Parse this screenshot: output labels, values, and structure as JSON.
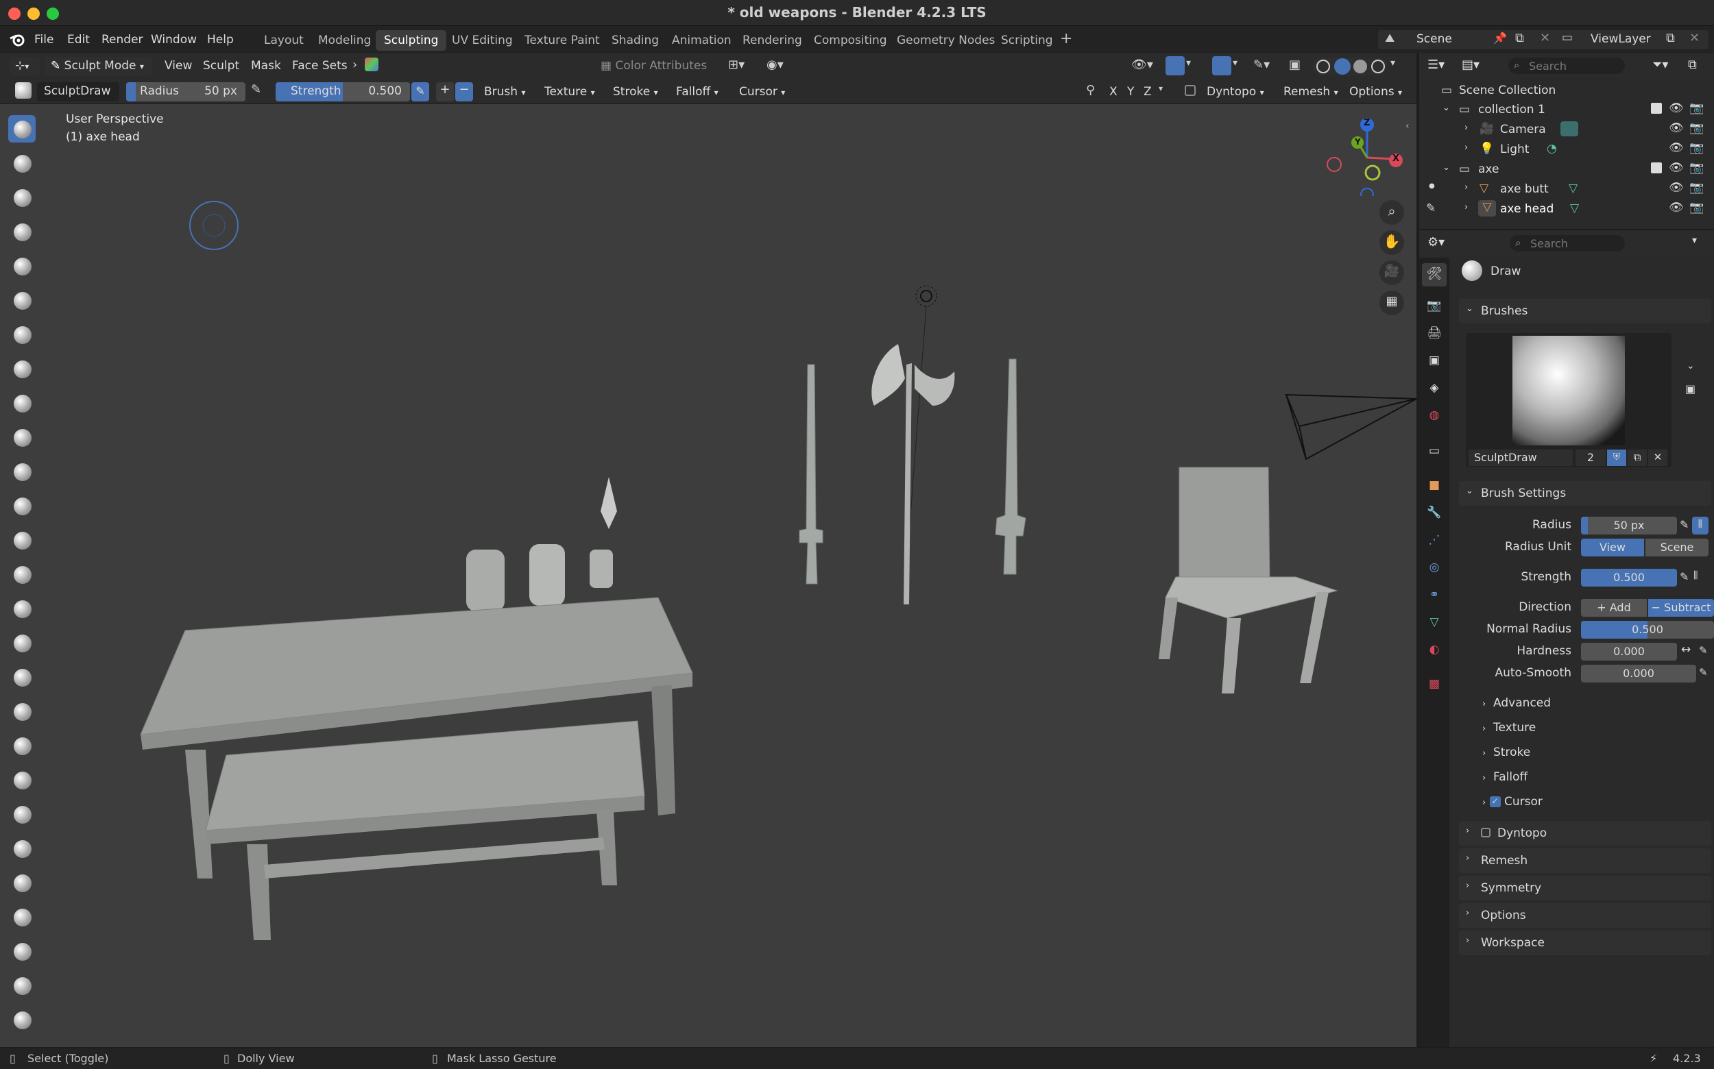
{
  "window": {
    "title": "* old weapons - Blender 4.2.3 LTS"
  },
  "menus": [
    "File",
    "Edit",
    "Render",
    "Window",
    "Help"
  ],
  "workspace_tabs": [
    {
      "label": "Layout",
      "active": false
    },
    {
      "label": "Modeling",
      "active": false
    },
    {
      "label": "Sculpting",
      "active": true
    },
    {
      "label": "UV Editing",
      "active": false
    },
    {
      "label": "Texture Paint",
      "active": false
    },
    {
      "label": "Shading",
      "active": false
    },
    {
      "label": "Animation",
      "active": false
    },
    {
      "label": "Rendering",
      "active": false
    },
    {
      "label": "Compositing",
      "active": false
    },
    {
      "label": "Geometry Nodes",
      "active": false
    },
    {
      "label": "Scripting",
      "active": false
    }
  ],
  "scene_selector": {
    "scene": "Scene",
    "view_layer": "ViewLayer"
  },
  "header": {
    "mode": "Sculpt Mode",
    "menus": [
      "View",
      "Sculpt",
      "Mask",
      "Face Sets"
    ],
    "color_attributes": "Color Attributes",
    "brush_name": "SculptDraw",
    "radius_label": "Radius",
    "radius_value": "50 px",
    "strength_label": "Strength",
    "strength_value": "0.500",
    "tool_menus": [
      "Brush",
      "Texture",
      "Stroke",
      "Falloff",
      "Cursor"
    ],
    "axes": [
      "X",
      "Y",
      "Z"
    ],
    "dyntopo": "Dyntopo",
    "remesh": "Remesh",
    "options": "Options"
  },
  "viewport": {
    "perspective": "User Perspective",
    "object": "(1) axe head",
    "gizmo_axes": {
      "z": "Z",
      "y": "Y",
      "x": "X"
    }
  },
  "outliner": {
    "search_placeholder": "Search",
    "root": "Scene Collection",
    "rows": [
      {
        "label": "collection 1",
        "type": "collection"
      },
      {
        "label": "Camera",
        "type": "camera"
      },
      {
        "label": "Light",
        "type": "light"
      },
      {
        "label": "axe",
        "type": "collection"
      },
      {
        "label": "axe butt",
        "type": "mesh"
      },
      {
        "label": "axe head",
        "type": "mesh"
      }
    ]
  },
  "properties": {
    "search_placeholder": "Search",
    "tool_name": "Draw",
    "brushes_panel": "Brushes",
    "brush_datablock": "SculptDraw",
    "brush_users": "2",
    "brush_settings_panel": "Brush Settings",
    "radius_label": "Radius",
    "radius_value": "50 px",
    "radius_unit_label": "Radius Unit",
    "radius_unit_view": "View",
    "radius_unit_scene": "Scene",
    "strength_label": "Strength",
    "strength_value": "0.500",
    "direction_label": "Direction",
    "direction_add": "Add",
    "direction_subtract": "Subtract",
    "normal_radius_label": "Normal Radius",
    "normal_radius_value": "0.500",
    "normal_radius_fraction": 0.5,
    "hardness_label": "Hardness",
    "hardness_value": "0.000",
    "autosmooth_label": "Auto-Smooth",
    "autosmooth_value": "0.000",
    "subpanels": [
      "Advanced",
      "Texture",
      "Stroke",
      "Falloff",
      "Cursor"
    ],
    "cursor_checked": true,
    "panels": [
      "Dyntopo",
      "Remesh",
      "Symmetry",
      "Options",
      "Workspace"
    ]
  },
  "statusbar": {
    "select": "Select (Toggle)",
    "dolly": "Dolly View",
    "mask": "Mask Lasso Gesture",
    "version": "4.2.3"
  },
  "colors": {
    "accent_blue": "#4772b3",
    "viewport_bg": "#3d3d3d",
    "active_tab": "#3d3d3d"
  }
}
